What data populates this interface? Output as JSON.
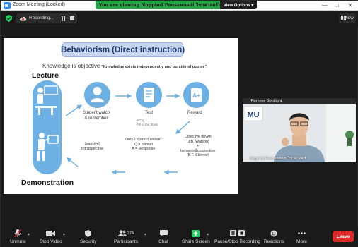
{
  "window": {
    "title": "Zoom Meeting (Locked)"
  },
  "banner": {
    "text": "You are viewing Nopphol Pausawasdi วิชาศาสตร์'s screen",
    "view_options": "View Options ▾"
  },
  "recording": {
    "label": "Recording..."
  },
  "view": {
    "label": "View"
  },
  "slide": {
    "title": "Behaviorism (Direct instruction)",
    "knowledge": "Knowledge is objective",
    "quote": "\"Knowledge exists independently and outside of people\"",
    "lecture": "Lecture",
    "demonstration": "Demonstration",
    "student_watch": "Student watch",
    "remember": "& remember",
    "test": "Test",
    "mcq": "-MCQ",
    "fill": "-Fill in the blank",
    "reward": "Reward",
    "objective_driven": "Objective driven",
    "watson": "(J.B. Watson)",
    "plus": "+",
    "behavior_connection": "behavior&connection",
    "skinner": "(B.F. Skinner)",
    "one_correct": "Only 1 correct answer",
    "q_stimuli": "Q = Stimuli",
    "a_response": "A = Response",
    "passive": "(passive)",
    "introspective": "Introspective",
    "mu_logo": "MU"
  },
  "camera": {
    "top_name": "Remove Spotlight",
    "name": "Nopphol Pausawasdi วิชาศาสตร์"
  },
  "toolbar": {
    "unmute": "Unmute",
    "stop_video": "Stop Video",
    "security": "Security",
    "participants": "Participants",
    "participants_count": "374",
    "chat": "Chat",
    "share_screen": "Share Screen",
    "pause_stop_recording": "Pause/Stop Recording",
    "reactions": "Reactions",
    "more": "More",
    "leave": "Leave"
  },
  "colors": {
    "zoom_blue": "#2d8cff",
    "banner_green": "#25a344",
    "leave_red": "#e02828",
    "slide_blue": "#6cb0e4"
  }
}
